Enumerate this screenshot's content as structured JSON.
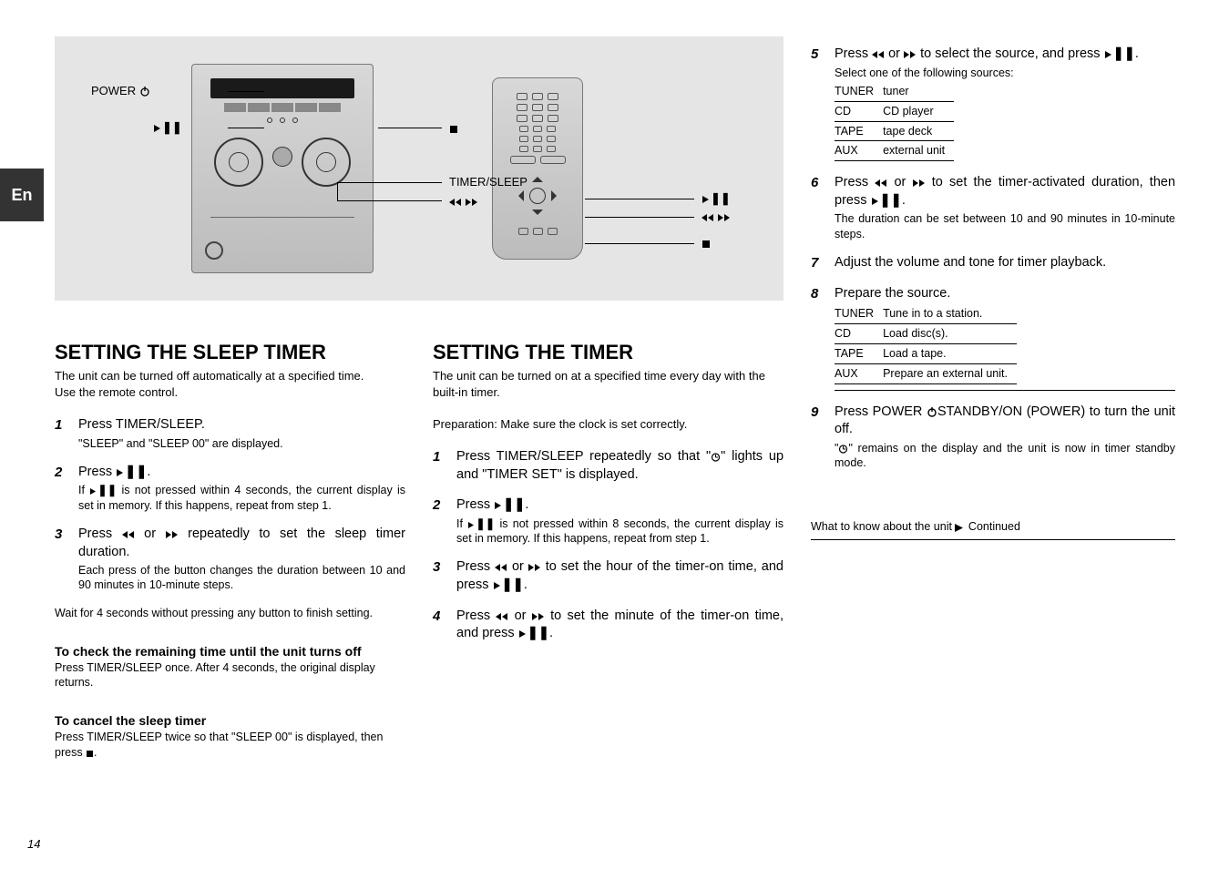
{
  "tab": "En",
  "diagram_labels": {
    "on_main_unit": {
      "power": "POWER",
      "pause": "eII",
      "stop": "s",
      "timer_sleep": "TIMER/SLEEP",
      "seek": "f g"
    },
    "on_remote": {
      "pause": "eII",
      "seek": "f g",
      "stop": "s"
    }
  },
  "sleep": {
    "title": "SETTING THE SLEEP TIMER",
    "intro": "The unit can be turned off automatically at a specified time.",
    "remote_note": "Use the remote control.",
    "steps": [
      {
        "main": "Press TIMER/SLEEP.",
        "explain": "\"SLEEP\" and \"SLEEP 00\" are displayed."
      },
      {
        "main_prefix": "Press ",
        "main_suffix": ".",
        "explain_pre": "If ",
        "explain_post": " is not pressed within 4 seconds, the current display is set in memory. If this happens, repeat from step 1."
      },
      {
        "main_prefix": "Press ",
        "main_mid": " or ",
        "main_suffix": " repeatedly to set the sleep timer duration.",
        "explain": "Each press of the button changes the duration between 10 and 90 minutes in 10-minute steps."
      }
    ],
    "wait4": "Wait for 4 seconds without pressing any button to finish setting.",
    "check_head": "To check the remaining time until the unit turns off",
    "check_body": "Press TIMER/SLEEP once. After 4 seconds, the original display returns.",
    "cancel_head": "To cancel the sleep timer",
    "cancel_body_pre": "Press TIMER/SLEEP twice so that \"SLEEP 00\" is displayed, then press ",
    "cancel_body_post": "."
  },
  "timer": {
    "title": "SETTING THE TIMER",
    "intro": "The unit can be turned on at a specified time every day with the built-in timer.",
    "prep": "Preparation: Make sure the clock is set correctly.",
    "steps": [
      {
        "main_prefix": "Press TIMER/SLEEP repeatedly so that \"",
        "main_mid": "\" lights up and \"",
        "highlight": "TIMER SET",
        "main_suffix": "\" is displayed."
      },
      {
        "main_prefix": "Press ",
        "main_suffix": ".",
        "explain_pre": "If ",
        "explain_post": " is not pressed within 8 seconds, the current display is set in memory. If this happens, repeat from step 1."
      },
      {
        "main_prefix": "Press ",
        "main_mid": " or ",
        "main_suffix": " to set the hour of the timer-on time, and press ",
        "main_end": "."
      },
      {
        "main_prefix": "Press ",
        "main_mid": " or ",
        "main_suffix": " to set the minute of the timer-on time, and press ",
        "main_end": "."
      }
    ]
  },
  "right_steps": {
    "s5": {
      "pre": "Press ",
      "mid": " or ",
      "post": " to select the source, and press ",
      "end": ".",
      "explain": "Select one of the following sources:",
      "table": [
        [
          "TUNER",
          "tuner"
        ],
        [
          "CD",
          "CD player"
        ],
        [
          "TAPE",
          "tape deck"
        ],
        [
          "AUX",
          "external unit"
        ]
      ]
    },
    "s6": {
      "pre": "Press ",
      "mid": " or ",
      "post": " to set the timer-activated duration, then press ",
      "end": ".",
      "explain": "The duration can be set between 10 and 90 minutes in 10-minute steps."
    },
    "s7": {
      "main": "Adjust the volume and tone for timer playback."
    },
    "s8": {
      "main": "Prepare the source.",
      "table": [
        [
          "TUNER",
          "Tune in to a station."
        ],
        [
          "CD",
          "Load disc(s)."
        ],
        [
          "TAPE",
          "Load a tape."
        ],
        [
          "AUX",
          "Prepare an external unit."
        ]
      ]
    },
    "s9": {
      "pre": "Press POWER ",
      "post": "STANDBY/ON (POWER) to turn the unit off.",
      "explain_pre": "\"",
      "explain_post": "\" remains on the display and the unit is now in timer standby mode."
    }
  },
  "know": {
    "heading_pre": "What to know about the unit ",
    "heading_post": "Continued",
    "page": "14"
  },
  "glyph": {
    "pause": "▶❚❚",
    "rew": "◀◀",
    "ff": "▶▶",
    "stop": "■",
    "power": "⏻",
    "clock": "⏲"
  }
}
